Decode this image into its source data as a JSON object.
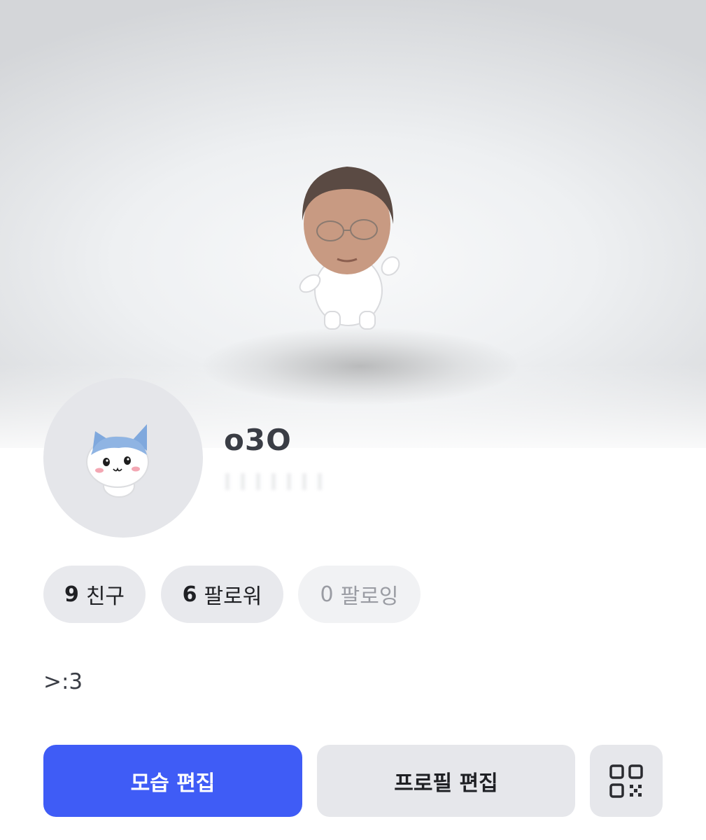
{
  "profile": {
    "username": "o3O",
    "bio": ">:3"
  },
  "stats": [
    {
      "count": "9",
      "label": "친구"
    },
    {
      "count": "6",
      "label": "팔로워"
    },
    {
      "count": "0",
      "label": "팔로잉"
    }
  ],
  "actions": {
    "edit_appearance": "모습 편집",
    "edit_profile": "프로필 편집",
    "qr_icon": "qr-code-icon"
  },
  "colors": {
    "primary": "#3f5cf6",
    "secondary_button": "#e6e7eb",
    "stat_pill": "#e8e9ed",
    "stat_pill_disabled": "#f1f2f4"
  }
}
